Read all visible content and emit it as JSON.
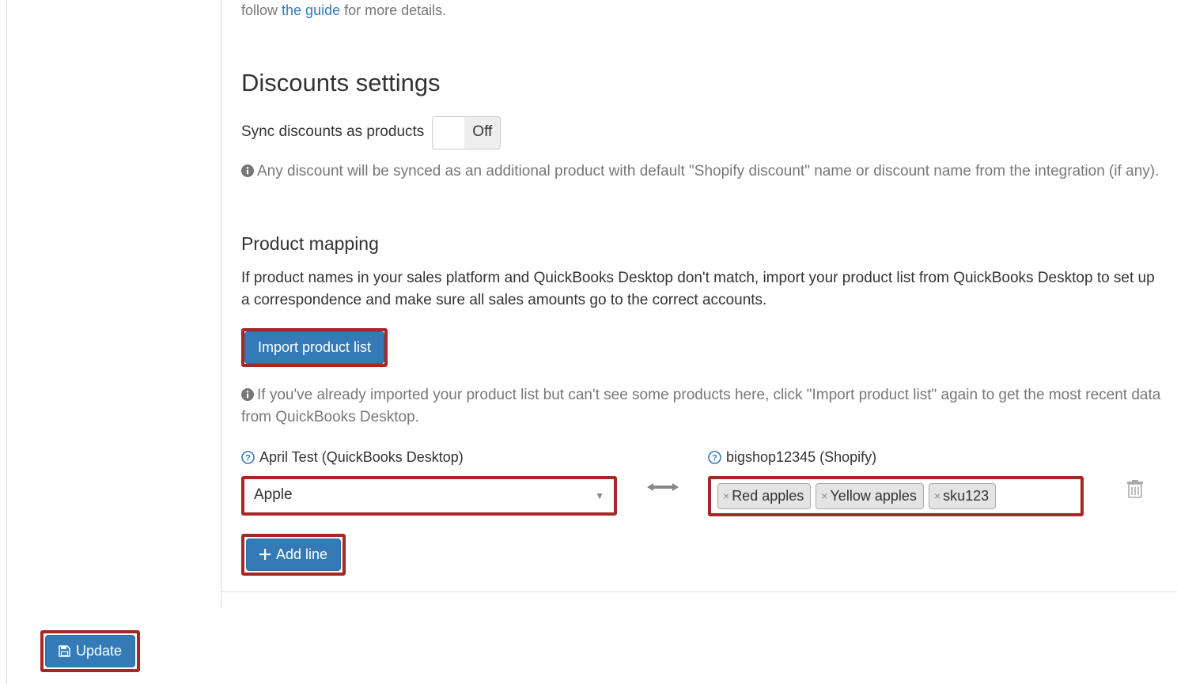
{
  "intro": {
    "prefix": "follow ",
    "link_text": "the guide",
    "suffix": " for more details."
  },
  "discounts": {
    "title": "Discounts settings",
    "sync_label": "Sync discounts as products",
    "toggle_state": "Off",
    "note": "Any discount will be synced as an additional product with default \"Shopify discount\" name or discount name from the integration (if any)."
  },
  "mapping": {
    "title": "Product mapping",
    "description": "If product names in your sales platform and QuickBooks Desktop don't match, import your product list from QuickBooks Desktop to set up a correspondence and make sure all sales amounts go to the correct accounts.",
    "import_btn": "Import product list",
    "post_note": "If you've already imported your product list but can't see some products here, click \"Import product list\" again to get the most recent data from QuickBooks Desktop.",
    "left_header": "April Test (QuickBooks Desktop)",
    "right_header": "bigshop12345 (Shopify)",
    "selected_product": "Apple",
    "tags": [
      "Red apples",
      "Yellow apples",
      "sku123"
    ],
    "add_line_btn": "Add line"
  },
  "footer": {
    "update_btn": "Update"
  }
}
